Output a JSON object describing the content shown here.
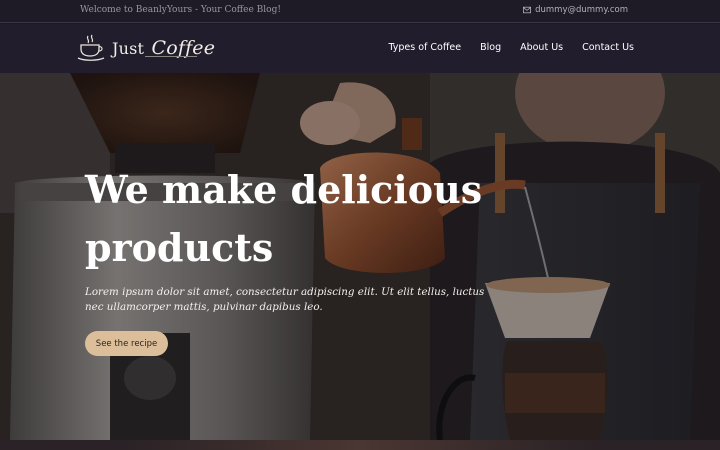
{
  "topbar": {
    "welcome": "Welcome to BeanlyYours - Your Coffee Blog!",
    "email": "dummy@dummy.com",
    "email_icon": "mail-icon"
  },
  "header": {
    "logo_icon": "coffee-cup-icon",
    "logo_word": "Just",
    "logo_em": "Coffee",
    "nav": [
      {
        "label": "Types of Coffee"
      },
      {
        "label": "Blog"
      },
      {
        "label": "About Us"
      },
      {
        "label": "Contact Us"
      }
    ]
  },
  "hero": {
    "title_line1": "We make delicious",
    "title_line2": "products",
    "text": "Lorem ipsum dolor sit amet, consectetur adipiscing elit. Ut elit tellus, luctus nec ullamcorper mattis, pulvinar dapibus leo.",
    "button": "See the recipe"
  },
  "colors": {
    "topbar_bg": "#1e1a26",
    "nav_bg": "#221d2c",
    "button_bg": "#dcbf9a"
  }
}
